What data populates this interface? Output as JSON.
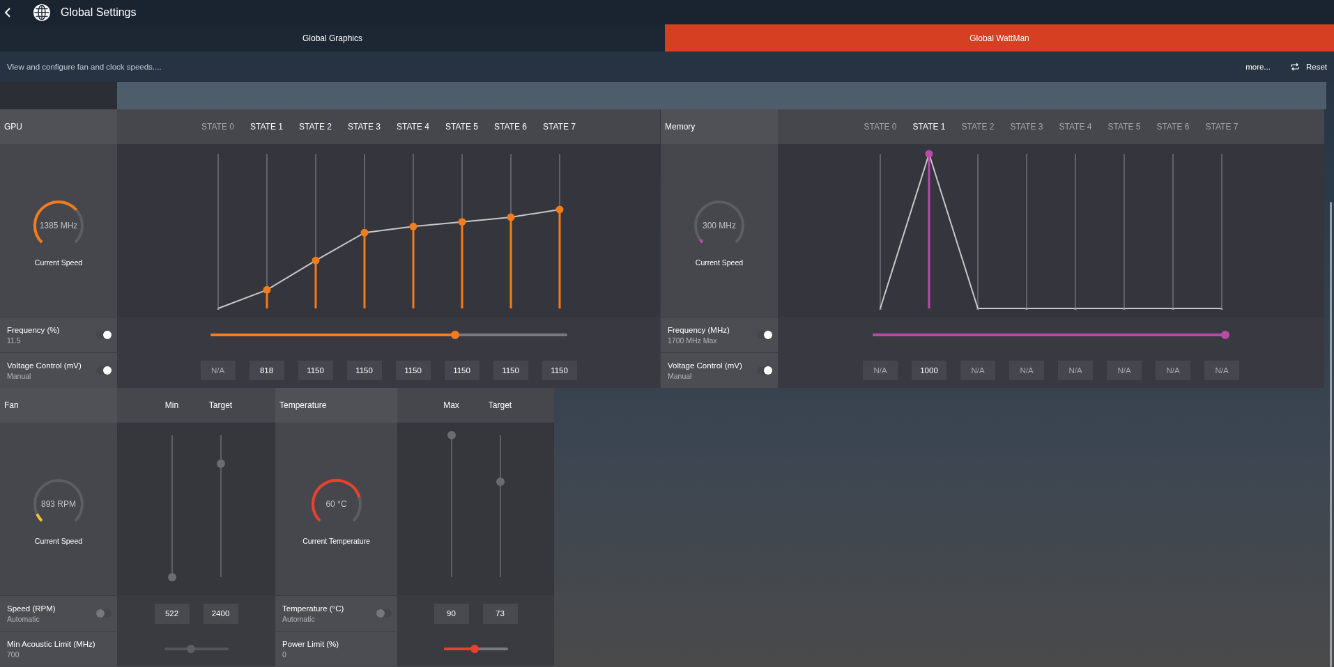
{
  "title": "Global Settings",
  "tabs": [
    {
      "label": "Global Graphics",
      "selected": false
    },
    {
      "label": "Global WattMan",
      "selected": true
    }
  ],
  "description": "View and configure fan and clock speeds....",
  "more": "more...",
  "reset": "Reset",
  "clock_panels": [
    {
      "name": "GPU",
      "color": "#f57c1a",
      "gauge": {
        "reading": "1385 MHz",
        "caption": "Current Speed",
        "level": 0.88
      },
      "states": [
        {
          "label": "STATE 0",
          "enabled": false,
          "level": 0.0,
          "voltage": "N/A"
        },
        {
          "label": "STATE 1",
          "enabled": true,
          "level": 0.12,
          "voltage": "818"
        },
        {
          "label": "STATE 2",
          "enabled": true,
          "level": 0.31,
          "voltage": "1150"
        },
        {
          "label": "STATE 3",
          "enabled": true,
          "level": 0.49,
          "voltage": "1150"
        },
        {
          "label": "STATE 4",
          "enabled": true,
          "level": 0.53,
          "voltage": "1150"
        },
        {
          "label": "STATE 5",
          "enabled": true,
          "level": 0.56,
          "voltage": "1150"
        },
        {
          "label": "STATE 6",
          "enabled": true,
          "level": 0.59,
          "voltage": "1150"
        },
        {
          "label": "STATE 7",
          "enabled": true,
          "level": 0.64,
          "voltage": "1150"
        }
      ],
      "frequency": {
        "label": "Frequency (%)",
        "value": "11.5",
        "on": true,
        "level": 0.69
      },
      "voltage": {
        "label": "Voltage Control (mV)",
        "value": "Manual",
        "on": true
      }
    },
    {
      "name": "Memory",
      "color": "#b94aa8",
      "gauge": {
        "reading": "300 MHz",
        "caption": "Current Speed",
        "level": 0.1
      },
      "states": [
        {
          "label": "STATE 0",
          "enabled": false,
          "level": 0.0,
          "voltage": "N/A"
        },
        {
          "label": "STATE 1",
          "enabled": true,
          "level": 1.0,
          "voltage": "1000"
        },
        {
          "label": "STATE 2",
          "enabled": false,
          "level": 0.0,
          "voltage": "N/A"
        },
        {
          "label": "STATE 3",
          "enabled": false,
          "level": 0.0,
          "voltage": "N/A"
        },
        {
          "label": "STATE 4",
          "enabled": false,
          "level": 0.0,
          "voltage": "N/A"
        },
        {
          "label": "STATE 5",
          "enabled": false,
          "level": 0.0,
          "voltage": "N/A"
        },
        {
          "label": "STATE 6",
          "enabled": false,
          "level": 0.0,
          "voltage": "N/A"
        },
        {
          "label": "STATE 7",
          "enabled": false,
          "level": 0.0,
          "voltage": "N/A"
        }
      ],
      "frequency": {
        "label": "Frequency (MHz)",
        "value": "1700 MHz Max",
        "on": true,
        "level": 1.0
      },
      "voltage": {
        "label": "Voltage Control (mV)",
        "value": "Manual",
        "on": true
      }
    }
  ],
  "cooling_panels": [
    {
      "name": "Fan",
      "color": "#f2c230",
      "gauge": {
        "reading": "893 RPM",
        "caption": "Current Speed",
        "level": 0.15
      },
      "columns": [
        {
          "label": "Min",
          "level": 0.0,
          "value": "522"
        },
        {
          "label": "Target",
          "level": 0.8,
          "value": "2400"
        }
      ],
      "control": {
        "label": "Speed (RPM)",
        "value": "Automatic",
        "on": false
      },
      "limit": {
        "label": "Min Acoustic Limit (MHz)",
        "value": "700",
        "level": 0.41,
        "disabled": true
      }
    },
    {
      "name": "Temperature",
      "color": "#e8412e",
      "gauge": {
        "reading": "60 °C",
        "caption": "Current Temperature",
        "level": 0.98
      },
      "columns": [
        {
          "label": "Max",
          "level": 1.0,
          "value": "90"
        },
        {
          "label": "Target",
          "level": 0.67,
          "value": "73"
        }
      ],
      "control": {
        "label": "Temperature (°C)",
        "value": "Automatic",
        "on": false
      },
      "limit": {
        "label": "Power Limit (%)",
        "value": "0",
        "level": 0.48,
        "disabled": false
      }
    }
  ]
}
